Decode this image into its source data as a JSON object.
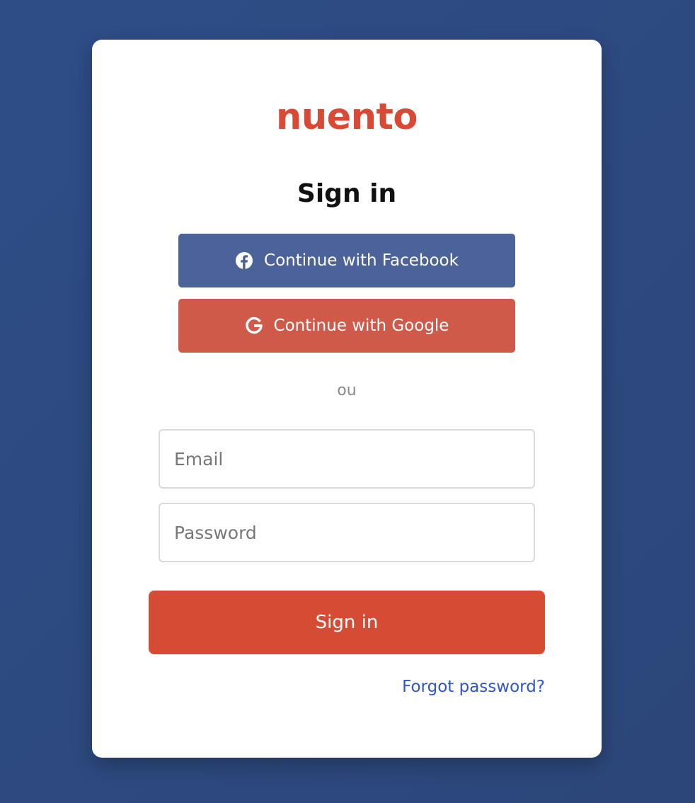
{
  "brand": {
    "name": "nuento",
    "color": "#d84a35"
  },
  "auth": {
    "title": "Sign in",
    "facebook_label": "Continue with Facebook",
    "google_label": "Continue with Google",
    "divider_text": "ou",
    "email_placeholder": "Email",
    "password_placeholder": "Password",
    "submit_label": "Sign in",
    "forgot_label": "Forgot password?"
  },
  "icons": {
    "facebook": "facebook-icon",
    "google": "google-icon"
  },
  "colors": {
    "background": "#2d4a82",
    "facebook": "#4c6399",
    "google": "#cf5a4a",
    "primary": "#d64b34",
    "link": "#2f55c9"
  }
}
